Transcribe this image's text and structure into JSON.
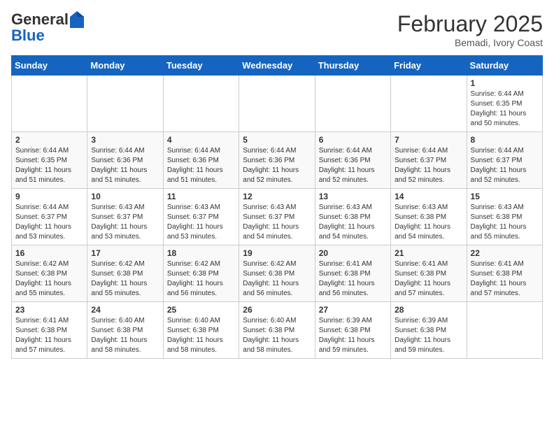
{
  "header": {
    "logo_general": "General",
    "logo_blue": "Blue",
    "month_year": "February 2025",
    "location": "Bemadi, Ivory Coast"
  },
  "weekdays": [
    "Sunday",
    "Monday",
    "Tuesday",
    "Wednesday",
    "Thursday",
    "Friday",
    "Saturday"
  ],
  "weeks": [
    [
      {
        "day": "",
        "info": ""
      },
      {
        "day": "",
        "info": ""
      },
      {
        "day": "",
        "info": ""
      },
      {
        "day": "",
        "info": ""
      },
      {
        "day": "",
        "info": ""
      },
      {
        "day": "",
        "info": ""
      },
      {
        "day": "1",
        "info": "Sunrise: 6:44 AM\nSunset: 6:35 PM\nDaylight: 11 hours\nand 50 minutes."
      }
    ],
    [
      {
        "day": "2",
        "info": "Sunrise: 6:44 AM\nSunset: 6:35 PM\nDaylight: 11 hours\nand 51 minutes."
      },
      {
        "day": "3",
        "info": "Sunrise: 6:44 AM\nSunset: 6:36 PM\nDaylight: 11 hours\nand 51 minutes."
      },
      {
        "day": "4",
        "info": "Sunrise: 6:44 AM\nSunset: 6:36 PM\nDaylight: 11 hours\nand 51 minutes."
      },
      {
        "day": "5",
        "info": "Sunrise: 6:44 AM\nSunset: 6:36 PM\nDaylight: 11 hours\nand 52 minutes."
      },
      {
        "day": "6",
        "info": "Sunrise: 6:44 AM\nSunset: 6:36 PM\nDaylight: 11 hours\nand 52 minutes."
      },
      {
        "day": "7",
        "info": "Sunrise: 6:44 AM\nSunset: 6:37 PM\nDaylight: 11 hours\nand 52 minutes."
      },
      {
        "day": "8",
        "info": "Sunrise: 6:44 AM\nSunset: 6:37 PM\nDaylight: 11 hours\nand 52 minutes."
      }
    ],
    [
      {
        "day": "9",
        "info": "Sunrise: 6:44 AM\nSunset: 6:37 PM\nDaylight: 11 hours\nand 53 minutes."
      },
      {
        "day": "10",
        "info": "Sunrise: 6:43 AM\nSunset: 6:37 PM\nDaylight: 11 hours\nand 53 minutes."
      },
      {
        "day": "11",
        "info": "Sunrise: 6:43 AM\nSunset: 6:37 PM\nDaylight: 11 hours\nand 53 minutes."
      },
      {
        "day": "12",
        "info": "Sunrise: 6:43 AM\nSunset: 6:37 PM\nDaylight: 11 hours\nand 54 minutes."
      },
      {
        "day": "13",
        "info": "Sunrise: 6:43 AM\nSunset: 6:38 PM\nDaylight: 11 hours\nand 54 minutes."
      },
      {
        "day": "14",
        "info": "Sunrise: 6:43 AM\nSunset: 6:38 PM\nDaylight: 11 hours\nand 54 minutes."
      },
      {
        "day": "15",
        "info": "Sunrise: 6:43 AM\nSunset: 6:38 PM\nDaylight: 11 hours\nand 55 minutes."
      }
    ],
    [
      {
        "day": "16",
        "info": "Sunrise: 6:42 AM\nSunset: 6:38 PM\nDaylight: 11 hours\nand 55 minutes."
      },
      {
        "day": "17",
        "info": "Sunrise: 6:42 AM\nSunset: 6:38 PM\nDaylight: 11 hours\nand 55 minutes."
      },
      {
        "day": "18",
        "info": "Sunrise: 6:42 AM\nSunset: 6:38 PM\nDaylight: 11 hours\nand 56 minutes."
      },
      {
        "day": "19",
        "info": "Sunrise: 6:42 AM\nSunset: 6:38 PM\nDaylight: 11 hours\nand 56 minutes."
      },
      {
        "day": "20",
        "info": "Sunrise: 6:41 AM\nSunset: 6:38 PM\nDaylight: 11 hours\nand 56 minutes."
      },
      {
        "day": "21",
        "info": "Sunrise: 6:41 AM\nSunset: 6:38 PM\nDaylight: 11 hours\nand 57 minutes."
      },
      {
        "day": "22",
        "info": "Sunrise: 6:41 AM\nSunset: 6:38 PM\nDaylight: 11 hours\nand 57 minutes."
      }
    ],
    [
      {
        "day": "23",
        "info": "Sunrise: 6:41 AM\nSunset: 6:38 PM\nDaylight: 11 hours\nand 57 minutes."
      },
      {
        "day": "24",
        "info": "Sunrise: 6:40 AM\nSunset: 6:38 PM\nDaylight: 11 hours\nand 58 minutes."
      },
      {
        "day": "25",
        "info": "Sunrise: 6:40 AM\nSunset: 6:38 PM\nDaylight: 11 hours\nand 58 minutes."
      },
      {
        "day": "26",
        "info": "Sunrise: 6:40 AM\nSunset: 6:38 PM\nDaylight: 11 hours\nand 58 minutes."
      },
      {
        "day": "27",
        "info": "Sunrise: 6:39 AM\nSunset: 6:38 PM\nDaylight: 11 hours\nand 59 minutes."
      },
      {
        "day": "28",
        "info": "Sunrise: 6:39 AM\nSunset: 6:38 PM\nDaylight: 11 hours\nand 59 minutes."
      },
      {
        "day": "",
        "info": ""
      }
    ]
  ]
}
